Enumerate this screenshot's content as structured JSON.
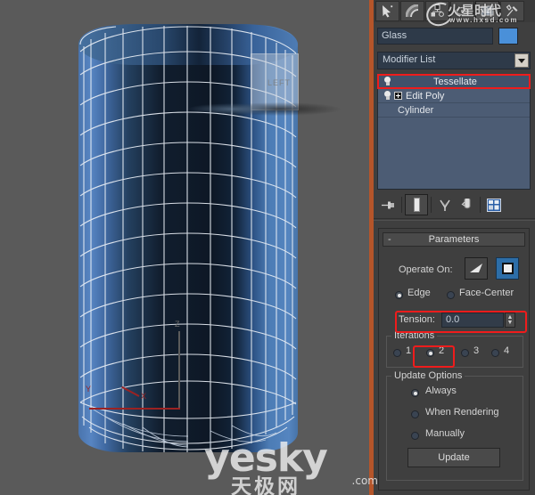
{
  "viewport": {
    "label": "",
    "ghost_label": "LEFT",
    "gizmo": {
      "z": "Z",
      "x": "X",
      "y": "Y"
    }
  },
  "panel": {
    "tabs": [
      {
        "name": "create-tab",
        "icon": "arrow-star-icon",
        "selected": false
      },
      {
        "name": "modify-tab",
        "icon": "rainbow-arc-icon",
        "selected": false
      },
      {
        "name": "hierarchy-tab",
        "icon": "hierarchy-nodes-icon",
        "selected": false
      },
      {
        "name": "motion-tab",
        "icon": "wheel-icon",
        "selected": false
      },
      {
        "name": "display-tab",
        "icon": "monitor-icon",
        "selected": true
      },
      {
        "name": "utilities-tab",
        "icon": "hammer-icon",
        "selected": false
      }
    ],
    "object_name": "Glass",
    "object_color": "#4a90d9",
    "modifier_list_label": "Modifier List",
    "stack": [
      {
        "label": "Tessellate",
        "selected": true,
        "has_bulb": true,
        "has_plus": false,
        "indent": "center"
      },
      {
        "label": "Edit Poly",
        "selected": false,
        "has_bulb": true,
        "has_plus": true,
        "indent": "ind"
      },
      {
        "label": "Cylinder",
        "selected": false,
        "has_bulb": false,
        "has_plus": false,
        "indent": "base"
      }
    ],
    "stack_tools": [
      {
        "name": "pin-stack-icon",
        "framed": false
      },
      {
        "name": "show-end-result-icon",
        "framed": true
      },
      {
        "name": "make-unique-icon",
        "framed": false
      },
      {
        "name": "remove-modifier-icon",
        "framed": false
      },
      {
        "name": "configure-modifier-sets-icon",
        "framed": false
      }
    ]
  },
  "parameters": {
    "rollout_title": "Parameters",
    "collapse_glyph": "-",
    "operate_on_label": "Operate On:",
    "operate_faces_icon": "triangle-face-icon",
    "operate_polygons_icon": "square-polygon-icon",
    "operate_selected": "polygons",
    "edge_label": "Edge",
    "face_center_label": "Face-Center",
    "edge_selected": true,
    "tension_label": "Tension:",
    "tension_value": "0.0",
    "iterations_group": "Iterations",
    "iterations_options": [
      "1",
      "2",
      "3",
      "4"
    ],
    "iterations_selected": "2",
    "update_group": "Update Options",
    "update_options": [
      "Always",
      "When Rendering",
      "Manually"
    ],
    "update_selected": "Always",
    "update_button": "Update"
  },
  "highlights": {
    "accent_color": "#ef1c1c"
  },
  "watermarks": {
    "top_cn": "火星时代",
    "top_url": "www.hxsd.com",
    "bottom_main": "yesky",
    "bottom_cn": "天极网",
    "bottom_tld": ".com"
  }
}
